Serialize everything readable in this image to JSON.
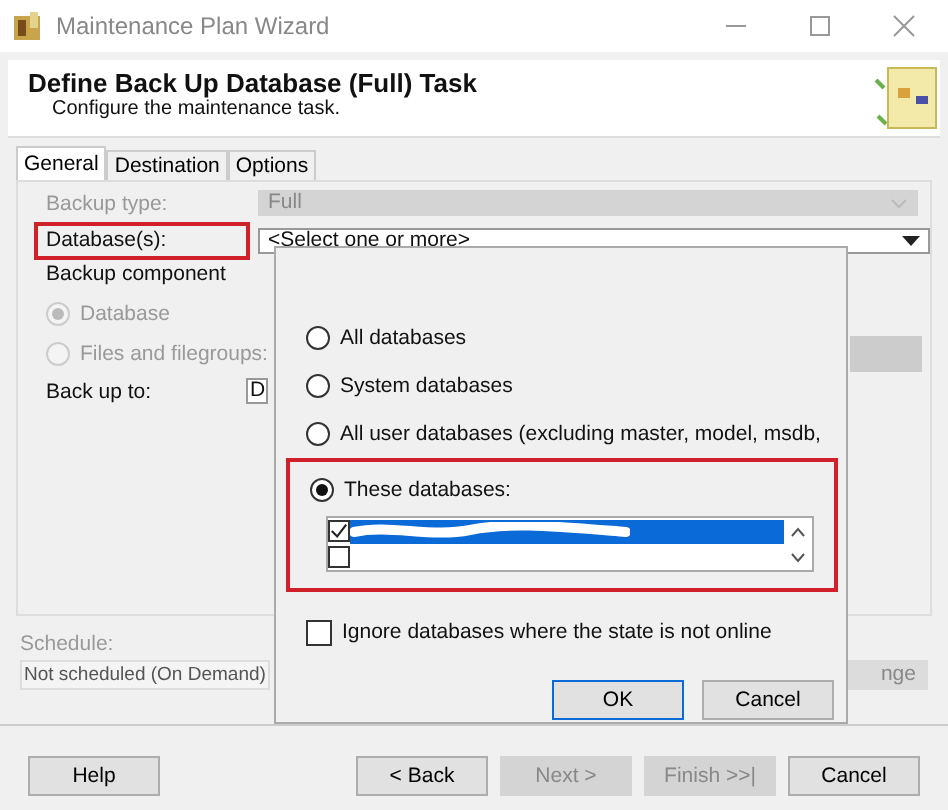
{
  "window": {
    "title": "Maintenance Plan Wizard"
  },
  "header": {
    "title": "Define Back Up Database (Full) Task",
    "subtitle": "Configure the maintenance task."
  },
  "tabs": [
    {
      "label": "General",
      "selected": true
    },
    {
      "label": "Destination",
      "selected": false
    },
    {
      "label": "Options",
      "selected": false
    }
  ],
  "backup_type": {
    "label": "Backup type:",
    "value": "Full",
    "disabled": true
  },
  "databases": {
    "label": "Database(s):",
    "value": "<Select one or more>",
    "highlighted": true
  },
  "backup_component": {
    "label": "Backup component",
    "options": [
      {
        "label": "Database",
        "selected": true,
        "disabled": true
      },
      {
        "label": "Files and filegroups:",
        "selected": false,
        "disabled": true
      }
    ]
  },
  "back_up_to": {
    "label": "Back up to:",
    "value": "D"
  },
  "schedule": {
    "label": "Schedule:",
    "value": "Not scheduled (On Demand)",
    "button": "nge"
  },
  "footer_buttons": [
    {
      "label": "Help",
      "disabled": false
    },
    {
      "label": "< Back",
      "disabled": false
    },
    {
      "label": "Next >",
      "disabled": true
    },
    {
      "label": "Finish >>|",
      "disabled": true
    },
    {
      "label": "Cancel",
      "disabled": false
    }
  ],
  "popup": {
    "options": [
      {
        "label": "All databases",
        "selected": false
      },
      {
        "label": "System databases",
        "selected": false
      },
      {
        "label": "All user databases  (excluding master, model, msdb,",
        "selected": false
      },
      {
        "label": "These databases:",
        "selected": true
      }
    ],
    "highlighted": true,
    "rows": [
      {
        "checked": true,
        "selected": true
      },
      {
        "checked": false,
        "selected": false
      }
    ],
    "ignore": {
      "label": "Ignore databases where the state is not online",
      "checked": false
    },
    "buttons": [
      {
        "label": "OK",
        "default": true
      },
      {
        "label": "Cancel",
        "default": false
      }
    ]
  }
}
